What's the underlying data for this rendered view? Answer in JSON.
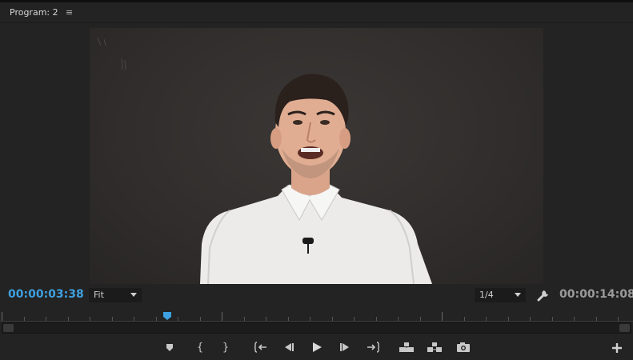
{
  "panel": {
    "title": "Program: 2",
    "menu_glyph": "≡"
  },
  "timecode": {
    "current": "00:00:03:38",
    "duration": "00:00:14:08"
  },
  "zoom": {
    "selected": "Fit"
  },
  "resolution": {
    "selected": "1/4"
  },
  "playback": {
    "position_fraction": 0.263
  },
  "controls": {
    "in_point_glyph": "{",
    "out_point_glyph": "}",
    "icons": [
      "marker-icon",
      "mark-in-icon",
      "mark-out-icon",
      "go-to-in-icon",
      "step-back-icon",
      "play-icon",
      "step-forward-icon",
      "go-to-out-icon",
      "lift-icon",
      "extract-icon",
      "export-frame-icon",
      "add-button-icon",
      "settings-wrench-icon"
    ]
  },
  "colors": {
    "accent": "#3ea0e0",
    "panel_bg": "#232323",
    "viewer_bg": "#302d2c"
  }
}
